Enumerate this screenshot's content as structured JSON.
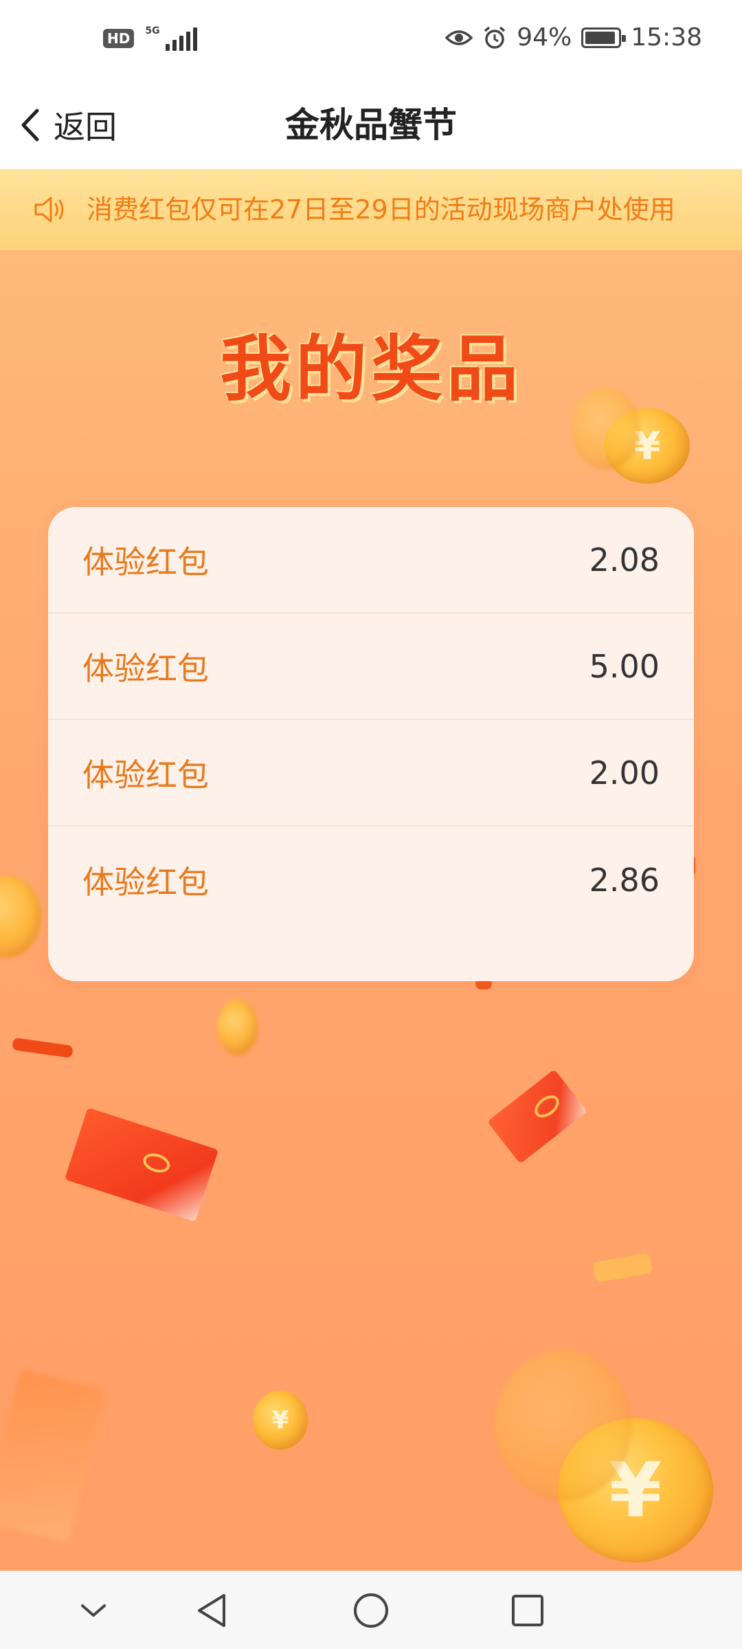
{
  "status_bar": {
    "hd_badge": "HD",
    "network": "5G",
    "eye_icon": "eye-icon",
    "alarm_icon": "alarm-icon",
    "battery_level": "94%",
    "battery_fraction": 0.94,
    "time": "15:38"
  },
  "header": {
    "back_label": "返回",
    "title": "金秋品蟹节"
  },
  "notice": {
    "icon": "speaker-icon",
    "text": "消费红包仅可在27日至29日的活动现场商户处使用"
  },
  "main": {
    "heading": "我的奖品",
    "prizes": [
      {
        "name": "体验红包",
        "amount": "2.08"
      },
      {
        "name": "体验红包",
        "amount": "5.00"
      },
      {
        "name": "体验红包",
        "amount": "2.00"
      },
      {
        "name": "体验红包",
        "amount": "2.86"
      }
    ],
    "coin_symbol": "¥"
  },
  "nav": {
    "collapse_icon": "chevron-down-icon",
    "back_icon": "triangle-back-icon",
    "home_icon": "circle-home-icon",
    "recents_icon": "square-recents-icon"
  },
  "colors": {
    "accent_orange": "#e8791c",
    "heading_red": "#f04a17",
    "notice_bg": "#ffd27b",
    "card_bg": "#fdf1ea"
  }
}
